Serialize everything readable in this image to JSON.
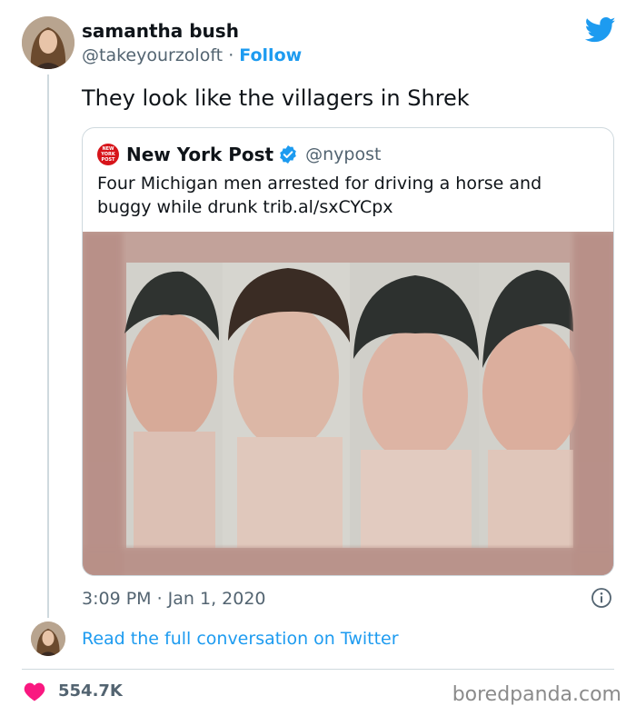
{
  "author": {
    "name": "samantha bush",
    "handle": "@takeyourzoloft",
    "separator": "·",
    "follow_label": "Follow"
  },
  "tweet": {
    "text": "They look like the villagers in Shrek",
    "timestamp": "3:09 PM · Jan 1, 2020"
  },
  "quoted": {
    "logo_text": "NEW YORK POST",
    "name": "New York Post",
    "handle": "@nypost",
    "text": "Four Michigan men arrested for driving a horse and buggy while drunk trib.al/sxCYCpx"
  },
  "read_link": "Read the full conversation on Twitter",
  "likes": "554.7K",
  "watermark": "boredpanda.com",
  "colors": {
    "twitter_blue": "#1d9bf0",
    "like_pink": "#f91880",
    "nyp_red": "#d7141a",
    "muted": "#536471"
  },
  "icons": [
    "twitter-bird-icon",
    "verified-badge-icon",
    "info-icon",
    "heart-icon"
  ]
}
